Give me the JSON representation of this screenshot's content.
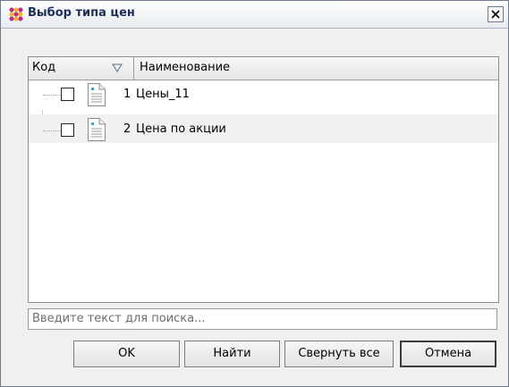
{
  "window": {
    "title": "Выбор типа цен"
  },
  "columns": {
    "code": "Код",
    "name": "Наименование"
  },
  "rows": [
    {
      "code": "1",
      "name": "Цены_11",
      "checked": false
    },
    {
      "code": "2",
      "name": "Цена по акции",
      "checked": false
    }
  ],
  "search": {
    "placeholder": "Введите текст для поиска...",
    "value": ""
  },
  "buttons": {
    "ok": "OK",
    "find": "Найти",
    "collapse": "Свернуть все",
    "cancel": "Отмена"
  }
}
